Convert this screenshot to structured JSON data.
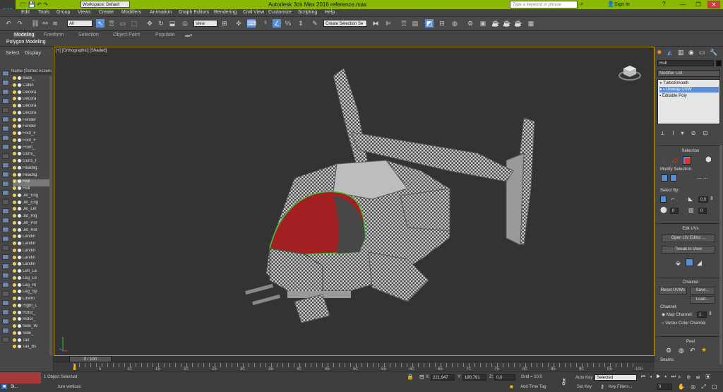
{
  "app": {
    "title": "Autodesk 3ds Max 2016     reference.max",
    "logo": "MAX",
    "workspace": "Workspace: Default",
    "search_placeholder": "Type a keyword or phrase",
    "sign_in": "Sign In"
  },
  "menu": [
    "Edit",
    "Tools",
    "Group",
    "Views",
    "Create",
    "Modifiers",
    "Animation",
    "Graph Editors",
    "Rendering",
    "Civil View",
    "Customize",
    "Scripting",
    "Help"
  ],
  "toolbar": {
    "filter": "All",
    "ref_coord": "View",
    "selection_set": "Create Selection Se"
  },
  "ribbon": {
    "tabs": [
      "Modeling",
      "Freeform",
      "Selection",
      "Object Paint",
      "Populate"
    ],
    "sub": "Polygon Modeling"
  },
  "scene_explorer": {
    "tabs": [
      "Select",
      "Display"
    ],
    "header": "Name (Sorted Ascend",
    "rows": [
      "Back_",
      "Cabin",
      "Decora",
      "Decora",
      "Decora",
      "Decora",
      "Fender",
      "Fender",
      "Foot_F",
      "Foot_F",
      "Front_",
      "Guns_",
      "Guns_F",
      "Headlig",
      "Headlig",
      "Hull",
      "Hull",
      "Jet_Eng",
      "Jet_Eng",
      "Jet_Lef",
      "Jet_Rig",
      "Jet_Pol",
      "Jet_Rot",
      "Landin",
      "Landin",
      "Landin",
      "Landin",
      "Landin",
      "Left_La",
      "Leg_Le",
      "Leg_Ri",
      "Leg_Sp",
      "LineRi",
      "Right_L",
      "Rotor_",
      "Rotor_",
      "Side_W",
      "Side_",
      "Tail",
      "Tail_Bs"
    ],
    "selected_index": 15
  },
  "viewport": {
    "label": "[+] [Orthographic] [Shaded]"
  },
  "command_panel": {
    "object_name": "Hull",
    "modifier_list": "Modifier List",
    "stack": [
      "TurboSmooth",
      "Unwrap UVW",
      "Editable Poly"
    ],
    "selection_title": "Selection",
    "modify_selection": "Modify Selection:",
    "select_by": "Select By:",
    "val1": "0,0",
    "val2": "0",
    "val3": "0",
    "edit_uvs_title": "Edit UVs",
    "open_uv_editor": "Open UV Editor ...",
    "tweak_in_view": "Tweak In View",
    "channel_title": "Channel",
    "reset_uvws": "Reset UVWs",
    "save": "Save...",
    "load": "Load...",
    "channel_label": "Channel:",
    "map_channel": "Map Channel:",
    "map_channel_value": "1",
    "vertex_color_channel": "Vertex Color Channel",
    "peel_title": "Peel",
    "seams": "Seams:"
  },
  "timeline": {
    "frame_label": "0 / 100",
    "ticks": [
      "0",
      "5",
      "10",
      "15",
      "20",
      "25",
      "30",
      "35",
      "40",
      "45",
      "50",
      "55",
      "60",
      "65",
      "70",
      "75",
      "80",
      "85",
      "90",
      "95",
      "100"
    ]
  },
  "status": {
    "objects": "1 Object Selected",
    "prompt": "ture vertices",
    "taskbar": "Sl...",
    "x_label": "X:",
    "x": "221,947",
    "y_label": "Y:",
    "y": "190,791",
    "z_label": "Z:",
    "z": "0,0",
    "grid": "Grid = 10,0",
    "add_time_tag": "Add Time Tag",
    "auto_key": "Auto Key",
    "auto_key_mode": "Selected",
    "set_key": "Set Key",
    "key_filters": "Key Filters...",
    "frame": "0"
  },
  "colors": {
    "title_bar": "#8ab800",
    "viewport_border": "#c8a000",
    "selection_highlight": "#5a8fd8"
  }
}
